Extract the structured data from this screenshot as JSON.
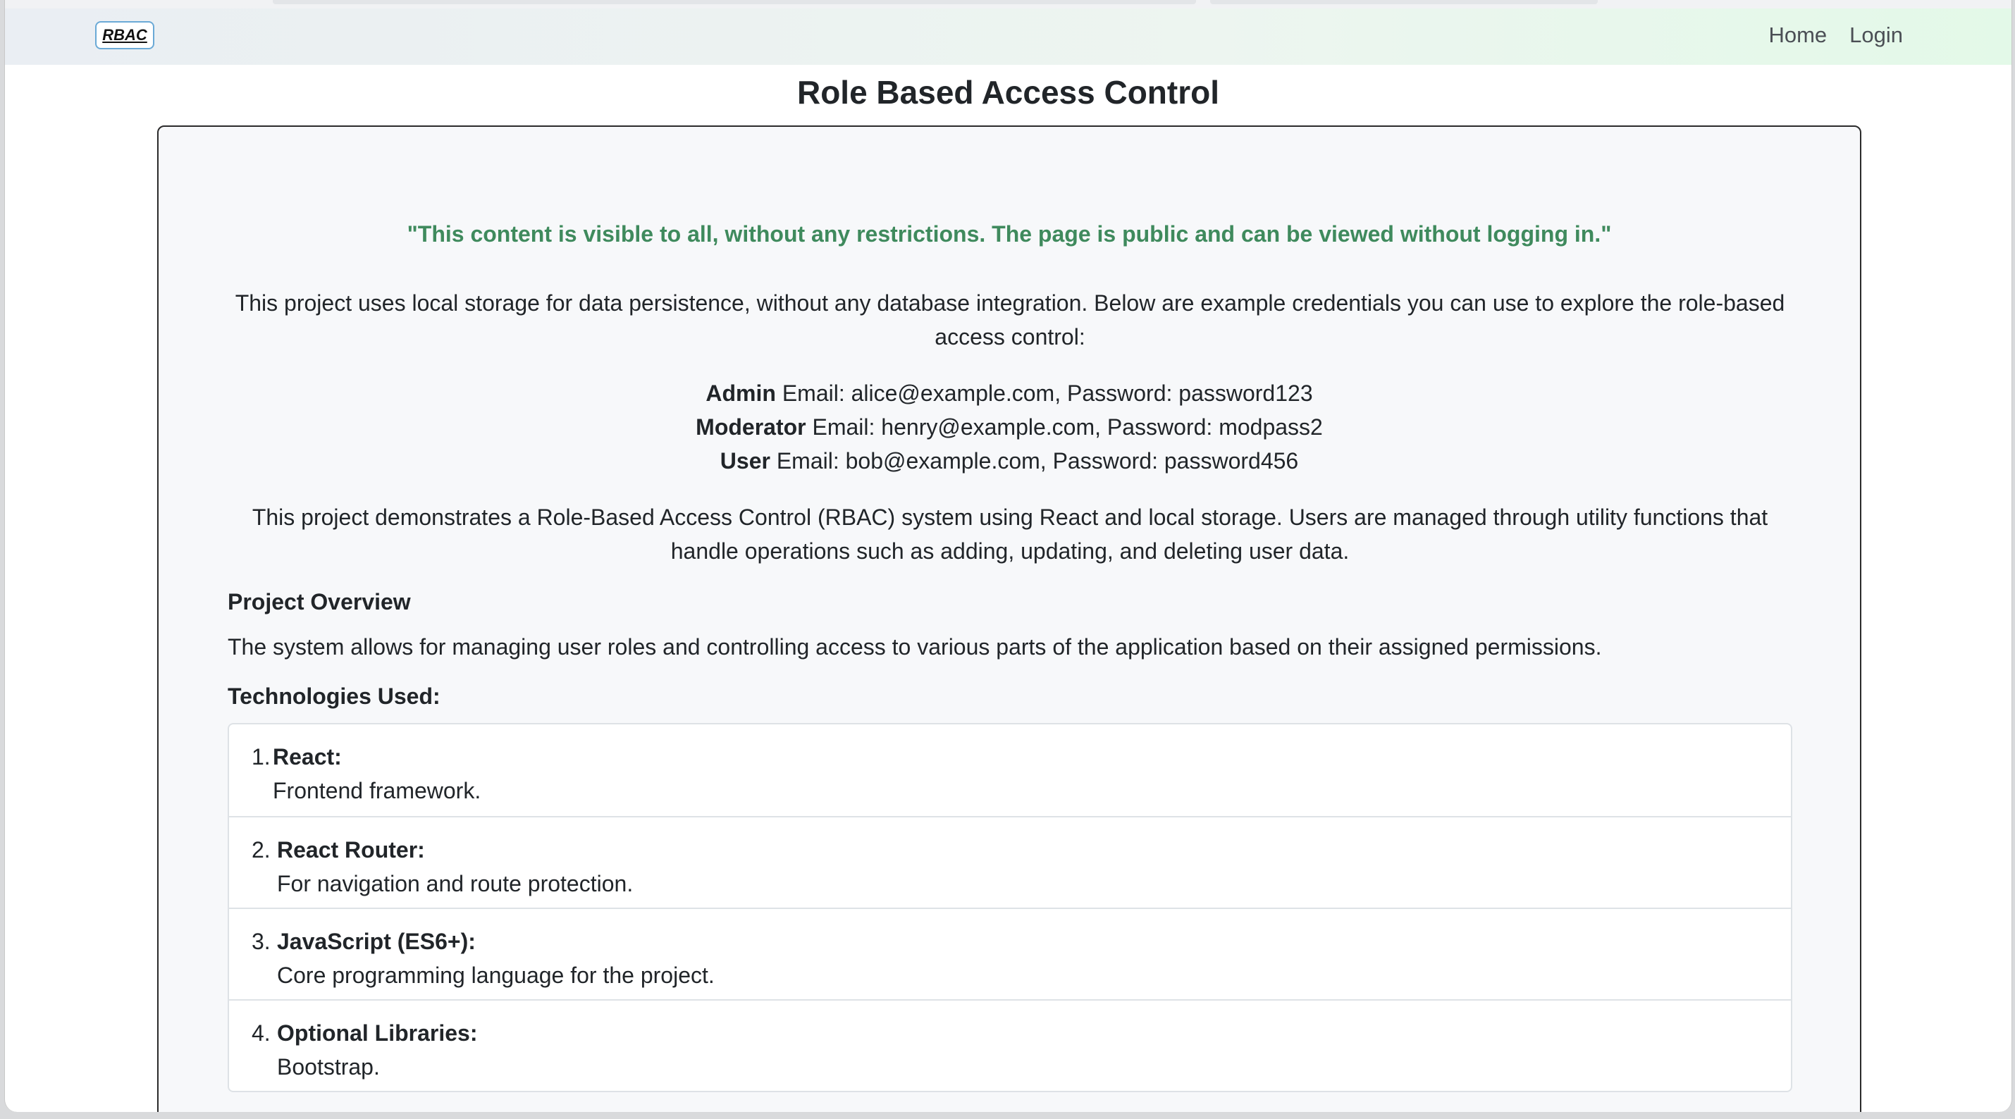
{
  "navbar": {
    "brand": "RBAC",
    "links": [
      "Home",
      "Login"
    ]
  },
  "page": {
    "title": "Role Based Access Control"
  },
  "card": {
    "quote": "\"This content is visible to all, without any restrictions. The page is public and can be viewed without logging in.\"",
    "intro": "This project uses local storage for data persistence, without any database integration. Below are example credentials you can use to explore the role-based access control:",
    "credentials": [
      {
        "role": "Admin",
        "text": "Email: alice@example.com, Password: password123"
      },
      {
        "role": "Moderator",
        "text": "Email: henry@example.com, Password: modpass2"
      },
      {
        "role": "User",
        "text": "Email: bob@example.com, Password: password456"
      }
    ],
    "description": "This project demonstrates a Role-Based Access Control (RBAC) system using React and local storage. Users are managed through utility functions that handle operations such as adding, updating, and deleting user data.",
    "overview_heading": "Project Overview",
    "overview_text": "The system allows for managing user roles and controlling access to various parts of the application based on their assigned permissions.",
    "tech_heading": "Technologies Used:",
    "technologies": [
      {
        "number": "1.",
        "name": "React:",
        "description": "Frontend framework."
      },
      {
        "number": "2.",
        "name": "React Router:",
        "description": "For navigation and route protection."
      },
      {
        "number": "3.",
        "name": "JavaScript (ES6+):",
        "description": "Core programming language for the project."
      },
      {
        "number": "4.",
        "name": "Optional Libraries:",
        "description": "Bootstrap."
      }
    ]
  },
  "colors": {
    "quote": "#3f8a5d",
    "text": "#212529",
    "card_bg": "#f7f8fa",
    "brand_border": "#6aa9d6"
  }
}
